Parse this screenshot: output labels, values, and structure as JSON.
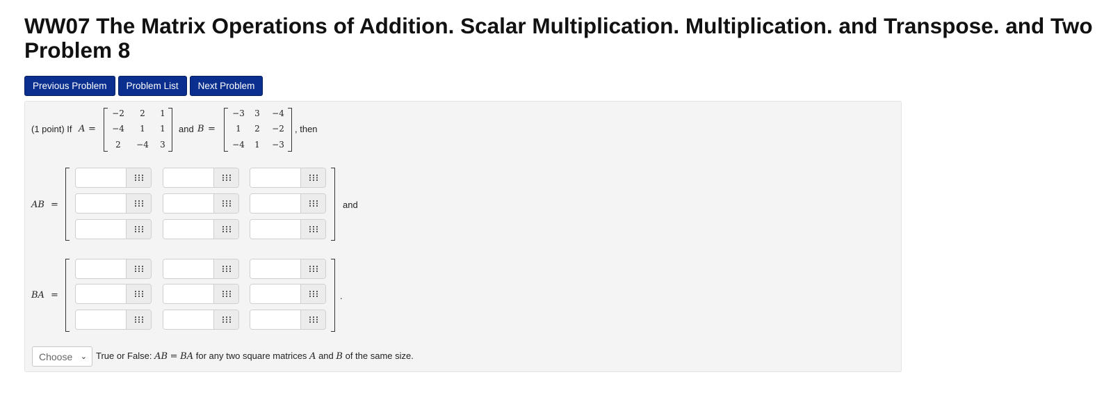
{
  "page": {
    "title_line1": "WW07 The Matrix Operations of Addition. Scalar Multiplication. Multiplication. and Transpose. and Two",
    "title_line2": "Problem 8"
  },
  "nav": {
    "previous": "Previous Problem",
    "list": "Problem List",
    "next": "Next Problem"
  },
  "problem": {
    "points": "(1 point) If",
    "A_label": "A",
    "eq": "=",
    "and_text": "and",
    "B_label": "B",
    "then_text": ", then",
    "matrix_A": [
      [
        "−2",
        "2",
        "1"
      ],
      [
        "−4",
        "1",
        "1"
      ],
      [
        "2",
        "−4",
        "3"
      ]
    ],
    "matrix_B": [
      [
        "−3",
        "3",
        "−4"
      ],
      [
        "1",
        "2",
        "−2"
      ],
      [
        "−4",
        "1",
        "−3"
      ]
    ],
    "AB_label": "AB",
    "BA_label": "BA",
    "after_AB": "and",
    "after_BA": ".",
    "true_false": {
      "select_value": "Choose",
      "prefix": "True or False:",
      "statement_mid": "for any two square matrices",
      "statement_and": "and",
      "statement_end": "of the same size."
    }
  },
  "icons": {
    "answer_helper": "matrix-grid-icon",
    "select": "chevron-down-icon"
  },
  "colors": {
    "nav_button": "#0a2f8f",
    "well_background": "#f4f4f4"
  }
}
